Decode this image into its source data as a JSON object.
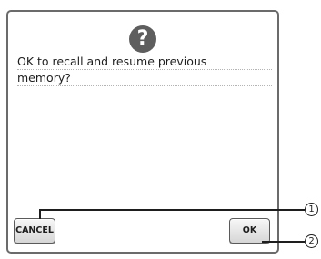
{
  "dialog": {
    "icon": "question-icon",
    "icon_glyph": "?",
    "message_lines": [
      "OK to recall and resume previous",
      "memory?"
    ]
  },
  "buttons": {
    "cancel_label": "CANCEL",
    "ok_label": "OK"
  },
  "callouts": [
    {
      "number": "1",
      "target": "cancel-button"
    },
    {
      "number": "2",
      "target": "ok-button"
    }
  ]
}
